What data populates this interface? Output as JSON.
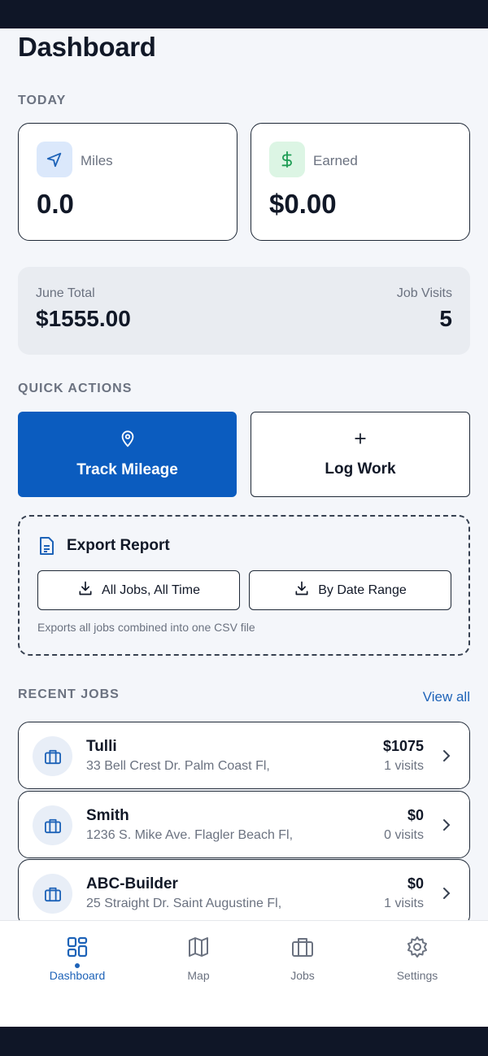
{
  "page_title": "Dashboard",
  "today": {
    "section_label": "TODAY",
    "miles": {
      "label": "Miles",
      "value": "0.0",
      "icon": "navigation-arrow-icon"
    },
    "earned": {
      "label": "Earned",
      "value": "$0.00",
      "icon": "dollar-icon"
    }
  },
  "month_summary": {
    "total_label": "June Total",
    "total_value": "$1555.00",
    "visits_label": "Job Visits",
    "visits_value": "5"
  },
  "quick_actions": {
    "section_label": "QUICK ACTIONS",
    "track_mileage": {
      "label": "Track Mileage",
      "icon": "location-pin-icon"
    },
    "log_work": {
      "label": "Log Work",
      "icon": "plus-icon"
    }
  },
  "export_report": {
    "title": "Export Report",
    "all_jobs_label": "All Jobs, All Time",
    "date_range_label": "By Date Range",
    "note": "Exports all jobs combined into one CSV file"
  },
  "recent_jobs": {
    "section_label": "RECENT JOBS",
    "view_all_label": "View all",
    "items": [
      {
        "name": "Tulli",
        "address": "33 Bell Crest Dr. Palm Coast Fl,",
        "amount": "$1075",
        "visits": "1 visits"
      },
      {
        "name": "Smith",
        "address": "1236 S. Mike Ave. Flagler Beach Fl,",
        "amount": "$0",
        "visits": "0 visits"
      },
      {
        "name": "ABC-Builder",
        "address": "25 Straight Dr. Saint Augustine Fl,",
        "amount": "$0",
        "visits": "1 visits"
      }
    ]
  },
  "nav": {
    "dashboard": "Dashboard",
    "map": "Map",
    "jobs": "Jobs",
    "settings": "Settings"
  },
  "colors": {
    "primary": "#0b5cbf",
    "accent_text": "#1e63b8",
    "miles_icon_bg": "#dbe8fb",
    "earned_icon_bg": "#dcf5e4",
    "earned_icon": "#1f9d55"
  }
}
